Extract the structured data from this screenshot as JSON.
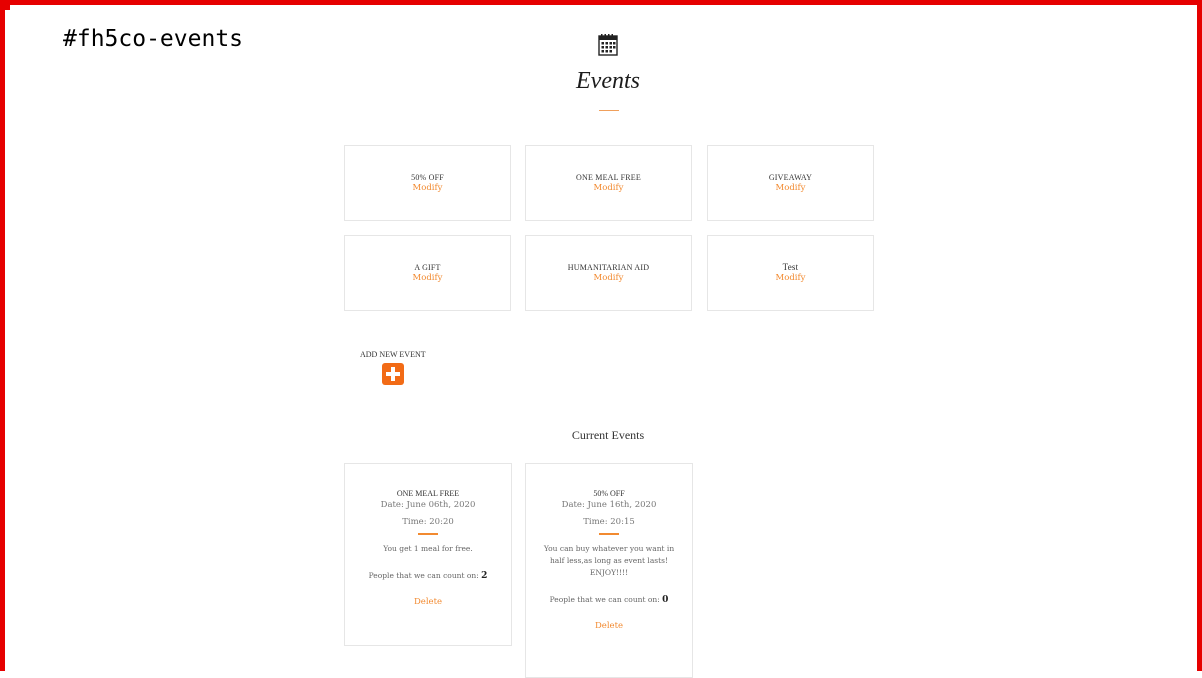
{
  "section_id": "#fh5co-events",
  "heading": "Events",
  "events": [
    {
      "name": "50% OFF",
      "modify": "Modify"
    },
    {
      "name": "ONE MEAL FREE",
      "modify": "Modify"
    },
    {
      "name": "GIVEAWAY",
      "modify": "Modify"
    },
    {
      "name": "A GIFT",
      "modify": "Modify"
    },
    {
      "name": "HUMANITARIAN AID",
      "modify": "Modify"
    },
    {
      "name": "Test",
      "modify": "Modify"
    }
  ],
  "add_event_label": "ADD NEW EVENT",
  "current_events_title": "Current Events",
  "current_events": [
    {
      "name": "ONE MEAL FREE",
      "date": "Date: June 06th, 2020",
      "time": "Time: 20:20",
      "description": "You get 1 meal for free.",
      "people_label": "People that we can count on:",
      "people_count": "2",
      "delete": "Delete"
    },
    {
      "name": "50% OFF",
      "date": "Date: June 16th, 2020",
      "time": "Time: 20:15",
      "description": "You can buy whatever you want in half less,as long as event lasts! ENJOY!!!!",
      "people_label": "People that we can count on:",
      "people_count": "0",
      "delete": "Delete"
    }
  ],
  "colors": {
    "accent": "#f28a30",
    "add_button": "#f26b16",
    "frame_border": "#e60000"
  },
  "icons": {
    "section": "calendar-icon",
    "add": "plus-icon"
  }
}
